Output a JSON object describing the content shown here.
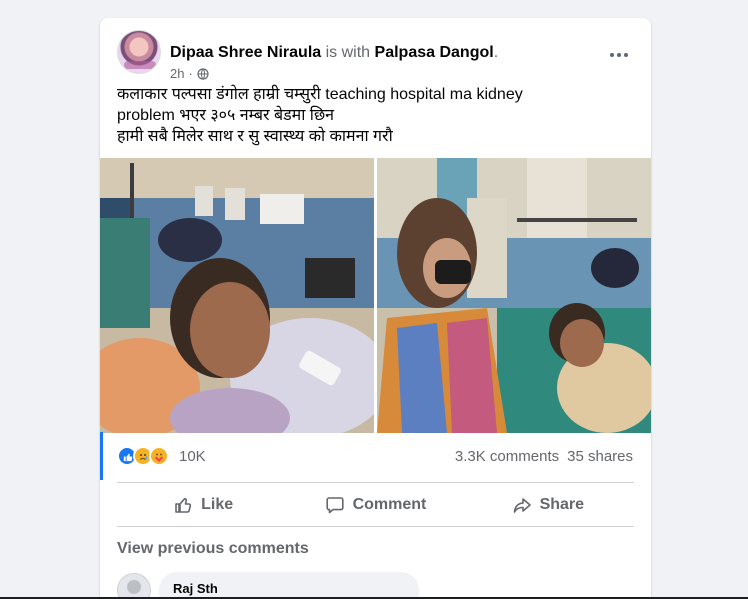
{
  "post": {
    "author": "Dipaa Shree Niraula",
    "with_text": "is with",
    "tagged": "Palpasa Dangol",
    "period": ".",
    "time": "2h",
    "audience_icon": "globe-icon",
    "text_lines": [
      "कलाकार पल्पसा डंगोल हाम्री चम्सुरी teaching hospital ma kidney",
      "problem भएर ३०५ नम्बर बेडमा छिन",
      "हामी सबै मिलेर साथ र सु स्वास्थ्य को कामना गरौ"
    ],
    "photos": [
      "photo-1",
      "photo-2"
    ]
  },
  "stats": {
    "reactions": [
      "like-reaction",
      "sad-reaction",
      "care-reaction"
    ],
    "reaction_count": "10K",
    "comments": "3.3K comments",
    "shares": "35 shares"
  },
  "actions": {
    "like": "Like",
    "comment": "Comment",
    "share": "Share"
  },
  "comments": {
    "view_previous": "View previous comments",
    "first_author": "Raj Sth"
  },
  "colors": {
    "accent": "#1877f2",
    "secondary_text": "#65676b",
    "background": "#f0f2f5"
  }
}
